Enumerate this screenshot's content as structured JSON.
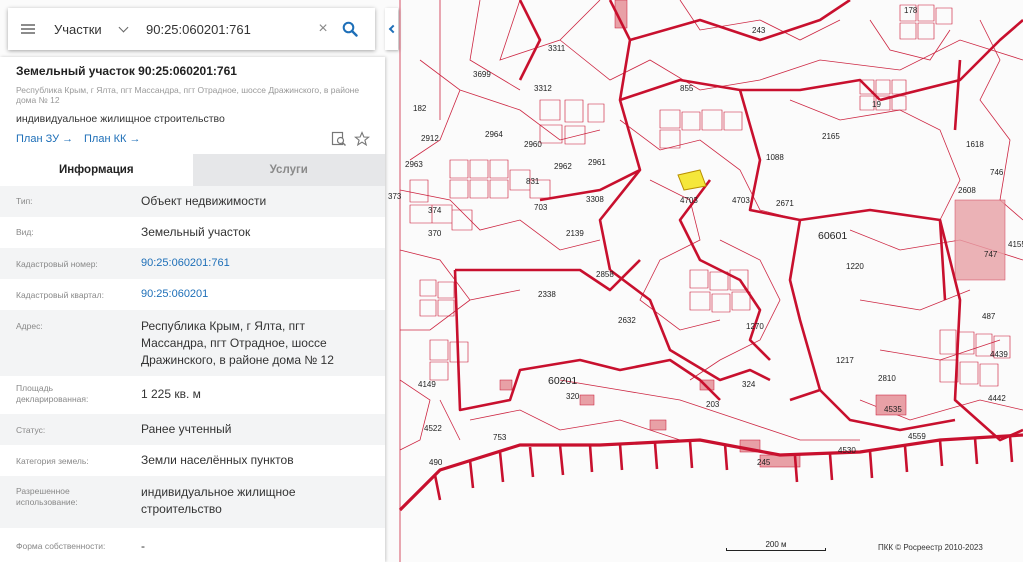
{
  "search": {
    "type_selected": "Участки",
    "query": "90:25:060201:761",
    "clear_symbol": "×"
  },
  "parcel": {
    "title": "Земельный участок 90:25:060201:761",
    "address_short": "Республика Крым, г Ялта, пгт Массандра, пгт Отрадное, шоссе Дражинского, в районе дома № 12",
    "usage": "индивидуальное жилищное строительство",
    "plan_zu": "План ЗУ",
    "plan_kk": "План КК"
  },
  "tabs": [
    {
      "label": "Информация",
      "active": true
    },
    {
      "label": "Услуги",
      "active": false
    }
  ],
  "info_rows": [
    {
      "label": "Тип:",
      "value": "Объект недвижимости"
    },
    {
      "label": "Вид:",
      "value": "Земельный участок"
    },
    {
      "label": "Кадастровый номер:",
      "value": "90:25:060201:761",
      "link": true
    },
    {
      "label": "Кадастровый квартал:",
      "value": "90:25:060201",
      "link": true
    },
    {
      "label": "Адрес:",
      "value": "Республика Крым, г Ялта, пгт Массандра, пгт Отрадное, шоссе Дражинского, в районе дома № 12"
    },
    {
      "label": "Площадь декларированная:",
      "value": "1 225 кв. м"
    },
    {
      "label": "Статус:",
      "value": "Ранее учтенный"
    },
    {
      "label": "Категория земель:",
      "value": "Земли населённых пунктов"
    },
    {
      "label": "Разрешенное использование:",
      "value": "индивидуальное жилищное строительство"
    },
    {
      "label": "Форма собственности:",
      "value": "-"
    }
  ],
  "map": {
    "scale": "200 м",
    "attribution": "ПКК © Росреестр 2010-2023",
    "parcel_numbers": [
      "3311",
      "3699",
      "3312",
      "182",
      "2912",
      "2963",
      "2964",
      "2960",
      "2962",
      "2961",
      "831",
      "703",
      "373",
      "374",
      "370",
      "2139",
      "3308",
      "4703",
      "2858",
      "2338",
      "2632",
      "60201",
      "320",
      "203",
      "753",
      "490",
      "4149",
      "4522",
      "855",
      "2165",
      "1088",
      "474",
      "2671",
      "60601",
      "1220",
      "1217",
      "1270",
      "324",
      "2810",
      "4535",
      "4530",
      "245",
      "4559",
      "1618",
      "746",
      "2608",
      "747",
      "487",
      "4155",
      "4439",
      "4442",
      "178",
      "243",
      "19"
    ],
    "colors": {
      "boundary": "#c8102e",
      "parcel_fill": "#fbfbfb",
      "highlight": "#f5e73b",
      "building": "#e8a0a6"
    }
  }
}
